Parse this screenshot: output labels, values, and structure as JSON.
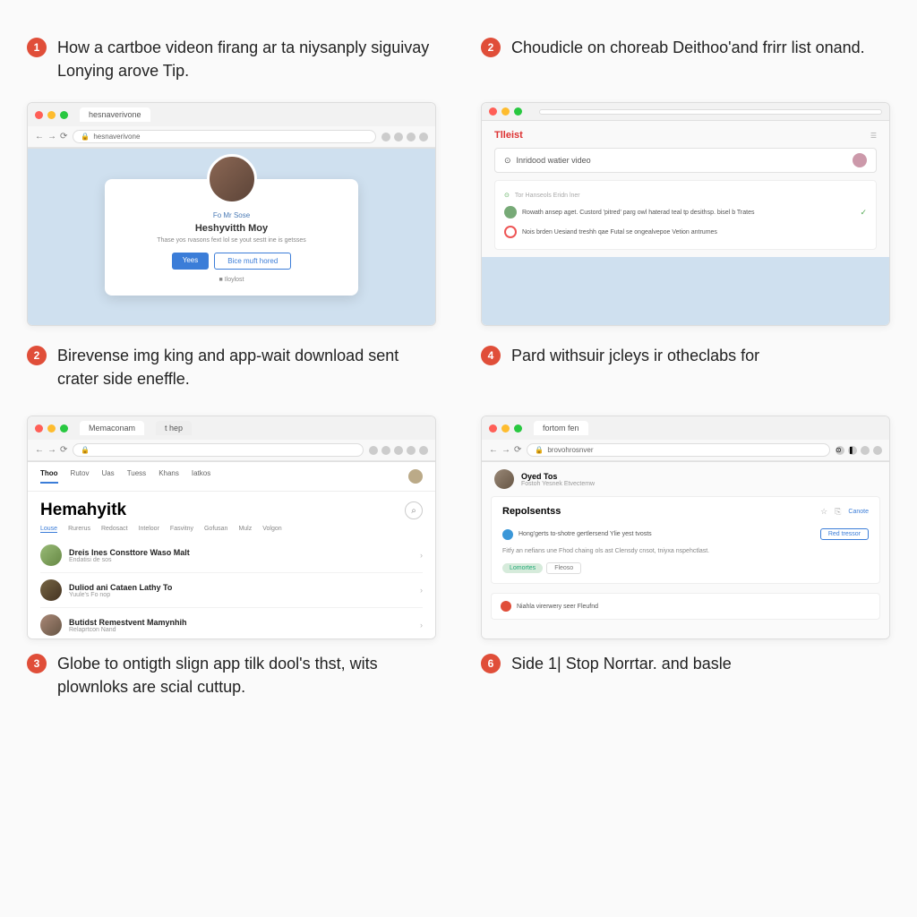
{
  "steps": [
    {
      "num": "1",
      "text": "How a cartboe videon firang ar ta niysanply siguivay Lonying arove Tip."
    },
    {
      "num": "2",
      "text": "Choudicle on choreab Deithoo'and frirr list onand."
    },
    {
      "num": "2",
      "text": "Birevense img king and app-wait download sent crater side eneffle."
    },
    {
      "num": "4",
      "text": "Pard withsuir jcleys ir otheclabs for"
    },
    {
      "num": "3",
      "text": "Globe to ontigth slign app tilk dool's thst, wits plownloks are scial cuttup."
    },
    {
      "num": "6",
      "text": "Side 1| Stop Norrtar. and basle"
    }
  ],
  "b1": {
    "tab": "hesnaverivone",
    "card_label": "Fo Mr Sose",
    "card_name": "Heshyvitth Moy",
    "card_desc": "Thase yos rvasons fext lol se yout sestt ine is getsses",
    "btn_primary": "Yees",
    "btn_secondary": "Bice muft hored",
    "foot": "Iloylost"
  },
  "b2": {
    "brand": "Tlleist",
    "search": "Inridood watier video",
    "res1_pre": "Tor Hanseols Eridn lner",
    "res1": "Rowath ansep aget. Custord 'pitred' parg owl haterad teal tp desithsp. bisel b Trates",
    "res2": "Nois brden Uesiand treshh qae Futal se ongealvepoe Vetion antrumes"
  },
  "b3": {
    "tab": "Memaconam",
    "tabs": [
      "Thoo",
      "Rutov",
      "Uas",
      "Tuess",
      "Khans",
      "Iatkos"
    ],
    "heading": "Hemahyitk",
    "subtabs": [
      "Louse",
      "Rurerus",
      "Redosact",
      "Inteloor",
      "Fasvitny",
      "Gofusan",
      "Mulz",
      "Volgon"
    ],
    "items": [
      {
        "t": "Dreis Ines Consttore Waso Malt",
        "s": "Endatisi de sos"
      },
      {
        "t": "Duliod ani Cataen Lathy To",
        "s": "Yuule's Fo nop"
      },
      {
        "t": "Butidst Remestvent Mamynhih",
        "s": "Relaprtcon Nand"
      }
    ]
  },
  "b4": {
    "tab": "fortom fen",
    "url": "brovohrosnver",
    "profile_name": "Oyed Tos",
    "profile_sub": "Fostoh Yesnek Etvectemw",
    "panel_title": "Repolsentss",
    "panel_link": "Canote",
    "item1": "Hong'gerts to-shotre gertlersend Ylie yest tvosts",
    "item1_btn": "Red tressor",
    "desc": "Fitfy an nefians une Fhod chaing ols ast Clensdy cnsot, tniyxa nspehctlast.",
    "pill1": "Lomortes",
    "pill2": "Fleoso",
    "alert": "Niahla virerwery seer Fleufnd"
  }
}
